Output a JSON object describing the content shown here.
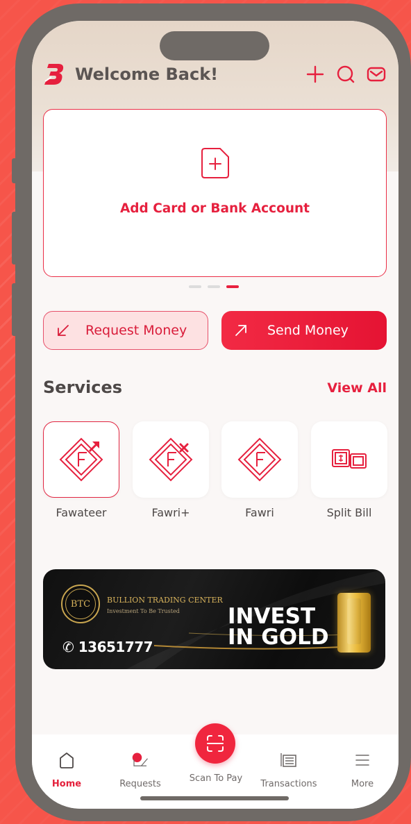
{
  "header": {
    "welcome": "Welcome Back!"
  },
  "card": {
    "label": "Add Card or Bank Account"
  },
  "carousel": {
    "count": 3,
    "active_index": 2
  },
  "actions": {
    "request_label": "Request Money",
    "send_label": "Send Money"
  },
  "services": {
    "title": "Services",
    "view_all": "View All",
    "items": [
      {
        "label": "Fawateer",
        "icon": "fawateer-icon"
      },
      {
        "label": "Fawri+",
        "icon": "fawri-plus-icon"
      },
      {
        "label": "Fawri",
        "icon": "fawri-icon"
      },
      {
        "label": "Split Bill",
        "icon": "split-bill-icon"
      }
    ]
  },
  "banner": {
    "logo_text": "BTC",
    "brand": "BULLION TRADING CENTER",
    "tagline": "Investment To Be Trusted",
    "phone": "13651777",
    "headline_line1": "INVEST",
    "headline_line2": "IN GOLD"
  },
  "nav": {
    "items": [
      {
        "label": "Home",
        "icon": "home-icon"
      },
      {
        "label": "Requests",
        "icon": "requests-icon"
      },
      {
        "label": "Scan To Pay",
        "icon": "scan-icon"
      },
      {
        "label": "Transactions",
        "icon": "transactions-icon"
      },
      {
        "label": "More",
        "icon": "menu-icon"
      }
    ],
    "active": "Home"
  },
  "colors": {
    "accent": "#e6203e",
    "background": "#f6554a",
    "frame": "#6f6a66",
    "gold": "#d8b35c"
  }
}
